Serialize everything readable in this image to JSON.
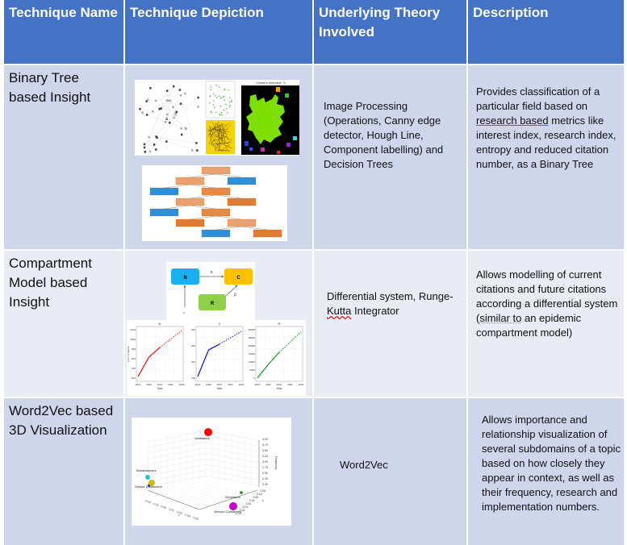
{
  "header": {
    "col1": "Technique Name",
    "col2": "Technique Depiction",
    "col3": "Underlying Theory Involved",
    "col4": "Description"
  },
  "rows": [
    {
      "name": "Binary Tree based Insight",
      "depiction": {
        "images": [
          "network graph of nodes",
          "scatter plot",
          "hough line plot",
          "cluster segmentation image",
          "decision tree diagram"
        ],
        "cluster_title": "Clusters detected : 9"
      },
      "theory": "Image Processing (Operations, Canny edge detector, Hough Line, Component labelling) and Decision Trees",
      "description_parts": {
        "before": "Provides classification of a particular field based on ",
        "underlined": "research based",
        "after": " metrics like interest index, research index,  entropy and reduced citation number, as a Binary Tree"
      }
    },
    {
      "name": "Compartment Model based Insight",
      "depiction": {
        "diagram_nodes": [
          "N",
          "C",
          "R"
        ],
        "edge_labels": [
          "α",
          "β",
          "λ"
        ],
        "charts": [
          {
            "title": "N",
            "ylabel": "Cum. Citations",
            "xlabel": "Year",
            "xticks": [
              "2019",
              "2020",
              "2021",
              "2022",
              "2023"
            ],
            "yticks": [
              "600",
              "700",
              "800",
              "900",
              "1000",
              "1100"
            ],
            "color": "#e02020"
          },
          {
            "title": "C",
            "xlabel": "Year",
            "xticks": [
              "2019",
              "2020",
              "2021",
              "2022",
              "2023"
            ],
            "yticks": [
              "150",
              "250",
              "300",
              "350"
            ],
            "color": "#1a1adc"
          },
          {
            "title": "R",
            "xlabel": "Year",
            "xticks": [
              "2019",
              "2020",
              "2021",
              "2022",
              "2023"
            ],
            "yticks": [
              "0",
              "5000",
              "10000",
              "15000",
              "20000",
              "25000",
              "30000"
            ],
            "color": "#1e9a2e"
          }
        ]
      },
      "theory_parts": {
        "before": "Differential system, Runge-",
        "misspelled": "Kutta",
        "after": " Integrator"
      },
      "description_parts": {
        "before": "Allows modelling of current citations and future citations according a differential system (",
        "underlined": "similar to",
        "after": " an epidemic compartment model)"
      }
    },
    {
      "name": "Word2Vec based 3D Visualization",
      "depiction": {
        "points": [
          {
            "label": "Ventilators",
            "color": "#ff0000"
          },
          {
            "label": "Breathalyzers",
            "color": "#29c0e0"
          },
          {
            "label": "Sensor Dispensers",
            "color": "#2020c0"
          },
          {
            "label": "",
            "color": "#c8c000"
          },
          {
            "label": "Simulators",
            "color": "#1a8a1a"
          },
          {
            "label": "Aerosol Containers",
            "color": "#cc00cc"
          }
        ],
        "zlabel": "Frequency",
        "xlabel": "x",
        "ylabel": "y",
        "zticks": [
          "2.00",
          "2.25",
          "2.50",
          "2.75",
          "3.00",
          "3.25",
          "3.50",
          "3.75",
          "4.00"
        ],
        "xticks": [
          "-0.02",
          "-0.01",
          "0.00",
          "0.01",
          "0.02",
          "0.03",
          "0.04"
        ],
        "yticks": [
          "-0.03",
          "-0.02",
          "-0.01",
          "0.00",
          "0.01",
          "0.02",
          "0.03",
          "0.04"
        ]
      },
      "theory": "Word2Vec",
      "description": "Allows importance and relationship visualization of several subdomains of a topic based on how closely they appear in context, as well as their frequency, research and implementation numbers."
    }
  ]
}
